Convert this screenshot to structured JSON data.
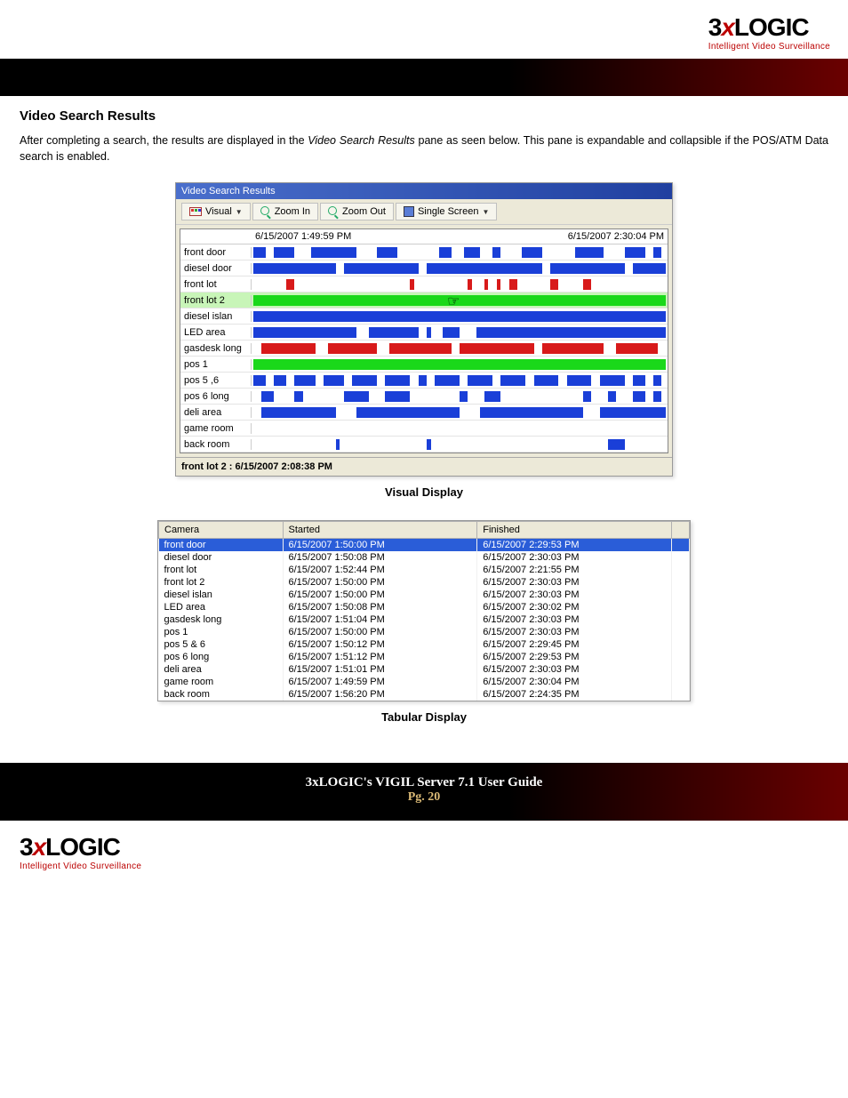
{
  "brand": {
    "name_3": "3",
    "name_x": "x",
    "name_logic": "LOGIC",
    "tagline": "Intelligent Video Surveillance"
  },
  "section": {
    "heading": "Video Search Results",
    "para_pre": "After completing a search, the results are displayed in the ",
    "para_em": "Video Search Results",
    "para_post": " pane as seen below. This pane is expandable and collapsible if the POS/ATM Data search is enabled."
  },
  "visual": {
    "window_title": "Video Search Results",
    "toolbar": {
      "mode": "Visual",
      "zoom_in": "Zoom In",
      "zoom_out": "Zoom Out",
      "single": "Single Screen"
    },
    "time_start": "6/15/2007 1:49:59 PM",
    "time_end": "6/15/2007 2:30:04 PM",
    "rows": [
      "front door",
      "diesel door",
      "front lot",
      "front lot 2",
      "diesel islan",
      "LED area",
      "gasdesk long",
      "pos 1",
      "pos 5 ,6",
      "pos 6 long",
      "deli area",
      "game room",
      "back room"
    ],
    "status": "front lot 2 : 6/15/2007 2:08:38 PM",
    "caption": "Visual Display"
  },
  "tabular": {
    "headers": [
      "Camera",
      "Started",
      "Finished"
    ],
    "rows": [
      {
        "c": "front door",
        "s": "6/15/2007 1:50:00 PM",
        "f": "6/15/2007 2:29:53 PM"
      },
      {
        "c": "diesel door",
        "s": "6/15/2007 1:50:08 PM",
        "f": "6/15/2007 2:30:03 PM"
      },
      {
        "c": "front lot",
        "s": "6/15/2007 1:52:44 PM",
        "f": "6/15/2007 2:21:55 PM"
      },
      {
        "c": "front lot 2",
        "s": "6/15/2007 1:50:00 PM",
        "f": "6/15/2007 2:30:03 PM"
      },
      {
        "c": "diesel islan",
        "s": "6/15/2007 1:50:00 PM",
        "f": "6/15/2007 2:30:03 PM"
      },
      {
        "c": "LED area",
        "s": "6/15/2007 1:50:08 PM",
        "f": "6/15/2007 2:30:02 PM"
      },
      {
        "c": "gasdesk long",
        "s": "6/15/2007 1:51:04 PM",
        "f": "6/15/2007 2:30:03 PM"
      },
      {
        "c": "pos 1",
        "s": "6/15/2007 1:50:00 PM",
        "f": "6/15/2007 2:30:03 PM"
      },
      {
        "c": "pos 5 & 6",
        "s": "6/15/2007 1:50:12 PM",
        "f": "6/15/2007 2:29:45 PM"
      },
      {
        "c": "pos 6 long",
        "s": "6/15/2007 1:51:12 PM",
        "f": "6/15/2007 2:29:53 PM"
      },
      {
        "c": "deli area",
        "s": "6/15/2007 1:51:01 PM",
        "f": "6/15/2007 2:30:03 PM"
      },
      {
        "c": "game room",
        "s": "6/15/2007 1:49:59 PM",
        "f": "6/15/2007 2:30:04 PM"
      },
      {
        "c": "back room",
        "s": "6/15/2007 1:56:20 PM",
        "f": "6/15/2007 2:24:35 PM"
      }
    ],
    "caption": "Tabular Display"
  },
  "footer": {
    "title": "3xLOGIC's VIGIL Server 7.1 User Guide",
    "page": "Pg. 20"
  },
  "chart_data": {
    "type": "table",
    "title": "Video Search Results — Tabular Display",
    "columns": [
      "Camera",
      "Started",
      "Finished"
    ],
    "rows": [
      [
        "front door",
        "6/15/2007 1:50:00 PM",
        "6/15/2007 2:29:53 PM"
      ],
      [
        "diesel door",
        "6/15/2007 1:50:08 PM",
        "6/15/2007 2:30:03 PM"
      ],
      [
        "front lot",
        "6/15/2007 1:52:44 PM",
        "6/15/2007 2:21:55 PM"
      ],
      [
        "front lot 2",
        "6/15/2007 1:50:00 PM",
        "6/15/2007 2:30:03 PM"
      ],
      [
        "diesel islan",
        "6/15/2007 1:50:00 PM",
        "6/15/2007 2:30:03 PM"
      ],
      [
        "LED area",
        "6/15/2007 1:50:08 PM",
        "6/15/2007 2:30:02 PM"
      ],
      [
        "gasdesk long",
        "6/15/2007 1:51:04 PM",
        "6/15/2007 2:30:03 PM"
      ],
      [
        "pos 1",
        "6/15/2007 1:50:00 PM",
        "6/15/2007 2:30:03 PM"
      ],
      [
        "pos 5 & 6",
        "6/15/2007 1:50:12 PM",
        "6/15/2007 2:29:45 PM"
      ],
      [
        "pos 6 long",
        "6/15/2007 1:51:12 PM",
        "6/15/2007 2:29:53 PM"
      ],
      [
        "deli area",
        "6/15/2007 1:51:01 PM",
        "6/15/2007 2:30:03 PM"
      ],
      [
        "game room",
        "6/15/2007 1:49:59 PM",
        "6/15/2007 2:30:04 PM"
      ],
      [
        "back room",
        "6/15/2007 1:56:20 PM",
        "6/15/2007 2:24:35 PM"
      ]
    ]
  }
}
